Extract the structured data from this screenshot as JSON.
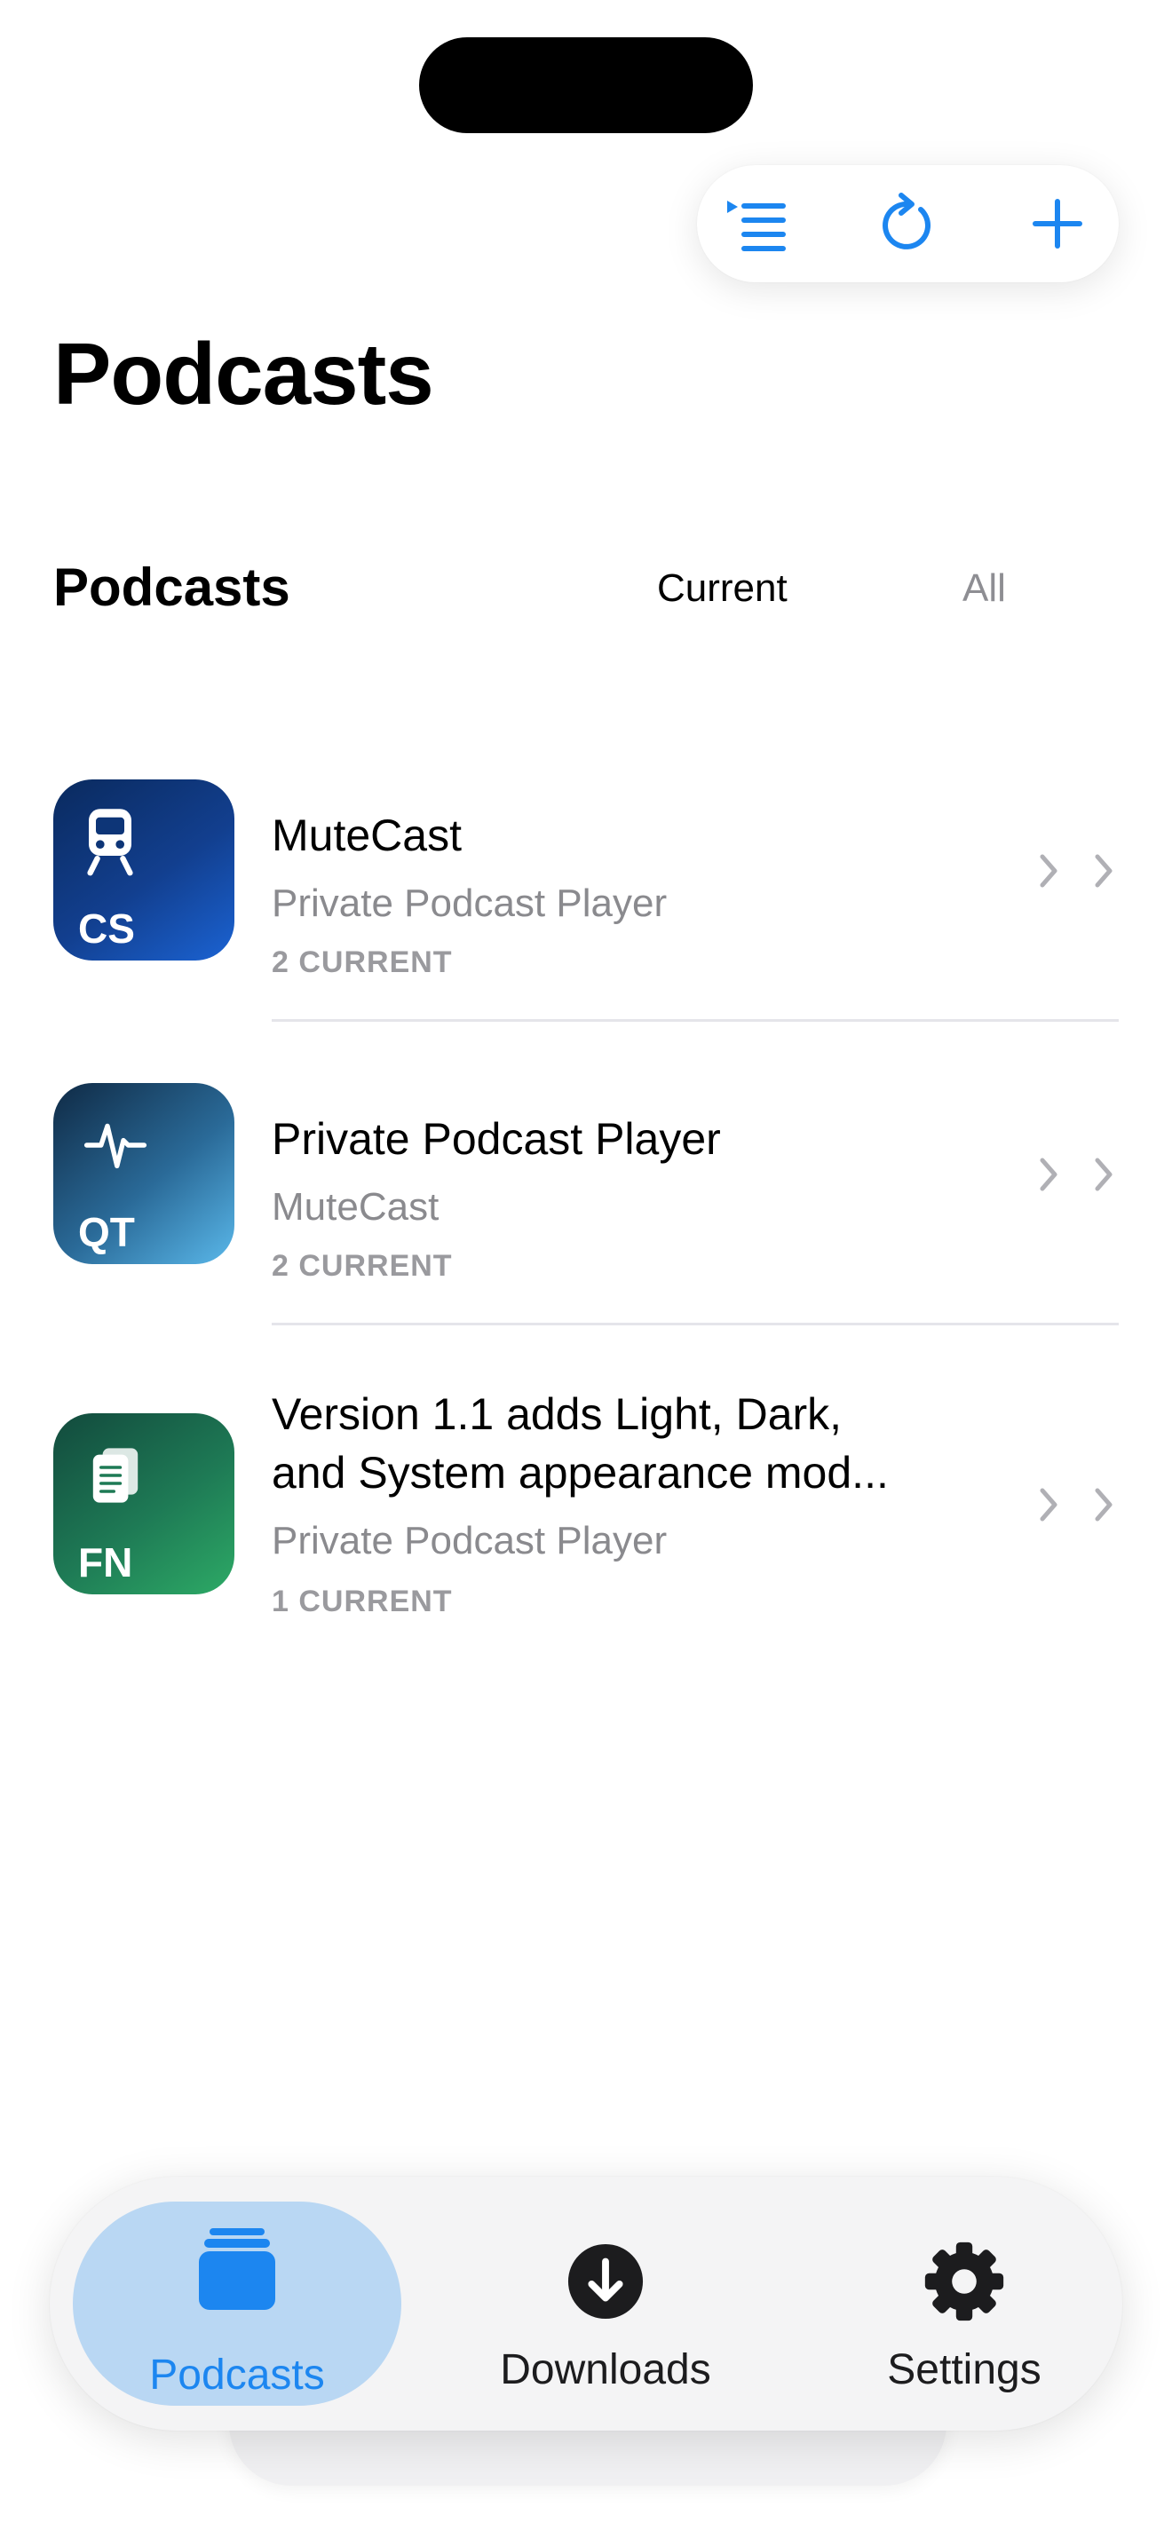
{
  "toolbar": {
    "queue_icon": "queue-list-icon",
    "refresh_icon": "refresh-icon",
    "add_icon": "plus-icon",
    "accent": "#1c86f0"
  },
  "page_title": "Podcasts",
  "section": {
    "title": "Podcasts",
    "segments": {
      "current": "Current",
      "all": "All"
    },
    "selected": "current"
  },
  "podcasts": [
    {
      "title": "MuteCast",
      "subtitle": "Private Podcast Player",
      "count": "2 CURRENT",
      "art_code": "CS",
      "art_icon": "train-icon",
      "art_colors": [
        "#0a2a5e",
        "#1b63d3"
      ]
    },
    {
      "title": "Private Podcast Player",
      "subtitle": "MuteCast",
      "count": "2 CURRENT",
      "art_code": "QT",
      "art_icon": "waveform-icon",
      "art_colors": [
        "#0f2a45",
        "#5ab8ea"
      ]
    },
    {
      "title_line1": "Version 1.1 adds Light, Dark,",
      "title_line2": "and System appearance mod...",
      "subtitle": "Private Podcast Player",
      "count": "1 CURRENT",
      "art_code": "FN",
      "art_icon": "documents-icon",
      "art_colors": [
        "#124a3d",
        "#2daa66"
      ]
    }
  ],
  "tabbar": {
    "tabs": [
      {
        "label": "Podcasts",
        "icon": "stack-icon",
        "active": true
      },
      {
        "label": "Downloads",
        "icon": "download-circle-icon",
        "active": false
      },
      {
        "label": "Settings",
        "icon": "gear-icon",
        "active": false
      }
    ]
  }
}
